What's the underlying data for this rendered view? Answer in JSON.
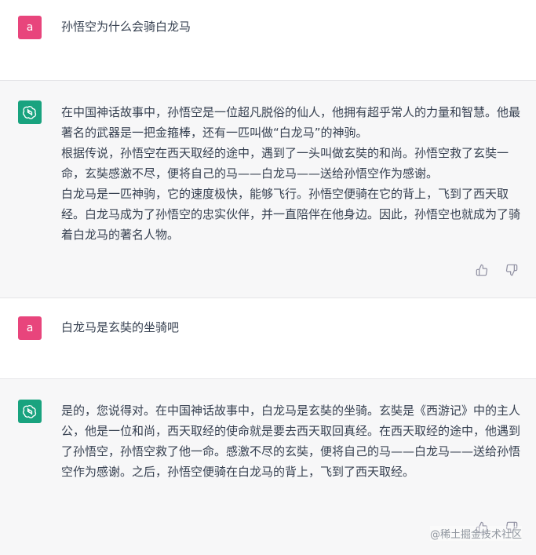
{
  "conversation": {
    "messages": [
      {
        "role": "user",
        "avatar_letter": "a",
        "paragraphs": [
          "孙悟空为什么会骑白龙马"
        ]
      },
      {
        "role": "assistant",
        "paragraphs": [
          "在中国神话故事中，孙悟空是一位超凡脱俗的仙人，他拥有超乎常人的力量和智慧。他最著名的武器是一把金箍棒，还有一匹叫做“白龙马”的神驹。",
          "根据传说，孙悟空在西天取经的途中，遇到了一头叫做玄奘的和尚。孙悟空救了玄奘一命，玄奘感激不尽，便将自己的马——白龙马——送给孙悟空作为感谢。",
          "白龙马是一匹神驹，它的速度极快，能够飞行。孙悟空便骑在它的背上，飞到了西天取经。白龙马成为了孙悟空的忠实伙伴，并一直陪伴在他身边。因此，孙悟空也就成为了骑着白龙马的著名人物。"
        ]
      },
      {
        "role": "user",
        "avatar_letter": "a",
        "paragraphs": [
          "白龙马是玄奘的坐骑吧"
        ]
      },
      {
        "role": "assistant",
        "paragraphs": [
          "是的，您说得对。在中国神话故事中，白龙马是玄奘的坐骑。玄奘是《西游记》中的主人公，他是一位和尚，西天取经的使命就是要去西天取回真经。在西天取经的途中，他遇到了孙悟空，孙悟空救了他一命。感激不尽的玄奘，便将自己的马——白龙马——送给孙悟空作为感谢。之后，孙悟空便骑在白龙马的背上，飞到了西天取经。"
        ]
      }
    ]
  },
  "icons": {
    "assistant_avatar": "openai-logo-icon",
    "thumbs_up": "thumbs-up-icon",
    "thumbs_down": "thumbs-down-icon"
  },
  "colors": {
    "user_avatar_bg": "#e8457c",
    "assistant_avatar_bg": "#19a37f",
    "assistant_row_bg": "#f7f7f8"
  },
  "watermark": "@稀土掘金技术社区"
}
